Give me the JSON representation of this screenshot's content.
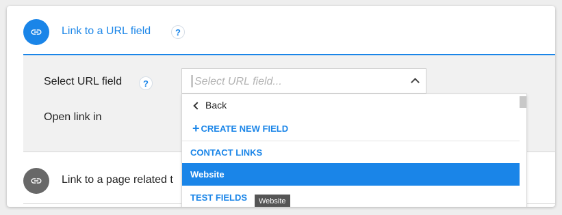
{
  "option_url": {
    "title": "Link to a URL field",
    "help": "?",
    "icon": "link-icon"
  },
  "panel": {
    "select_label": "Select URL field",
    "select_help": "?",
    "select_placeholder": "Select URL field...",
    "open_label": "Open link in"
  },
  "dropdown": {
    "back": "Back",
    "create_new": "CREATE NEW FIELD",
    "groups": [
      {
        "label": "CONTACT LINKS"
      },
      {
        "label": "TEST FIELDS"
      }
    ],
    "selected_item": "Website"
  },
  "option_page": {
    "title": "Link to a page related t",
    "icon": "link-icon"
  },
  "tooltip": "Website",
  "colors": {
    "accent": "#1a85e8",
    "panel": "#f1f1f1",
    "inactive_icon": "#686868"
  }
}
